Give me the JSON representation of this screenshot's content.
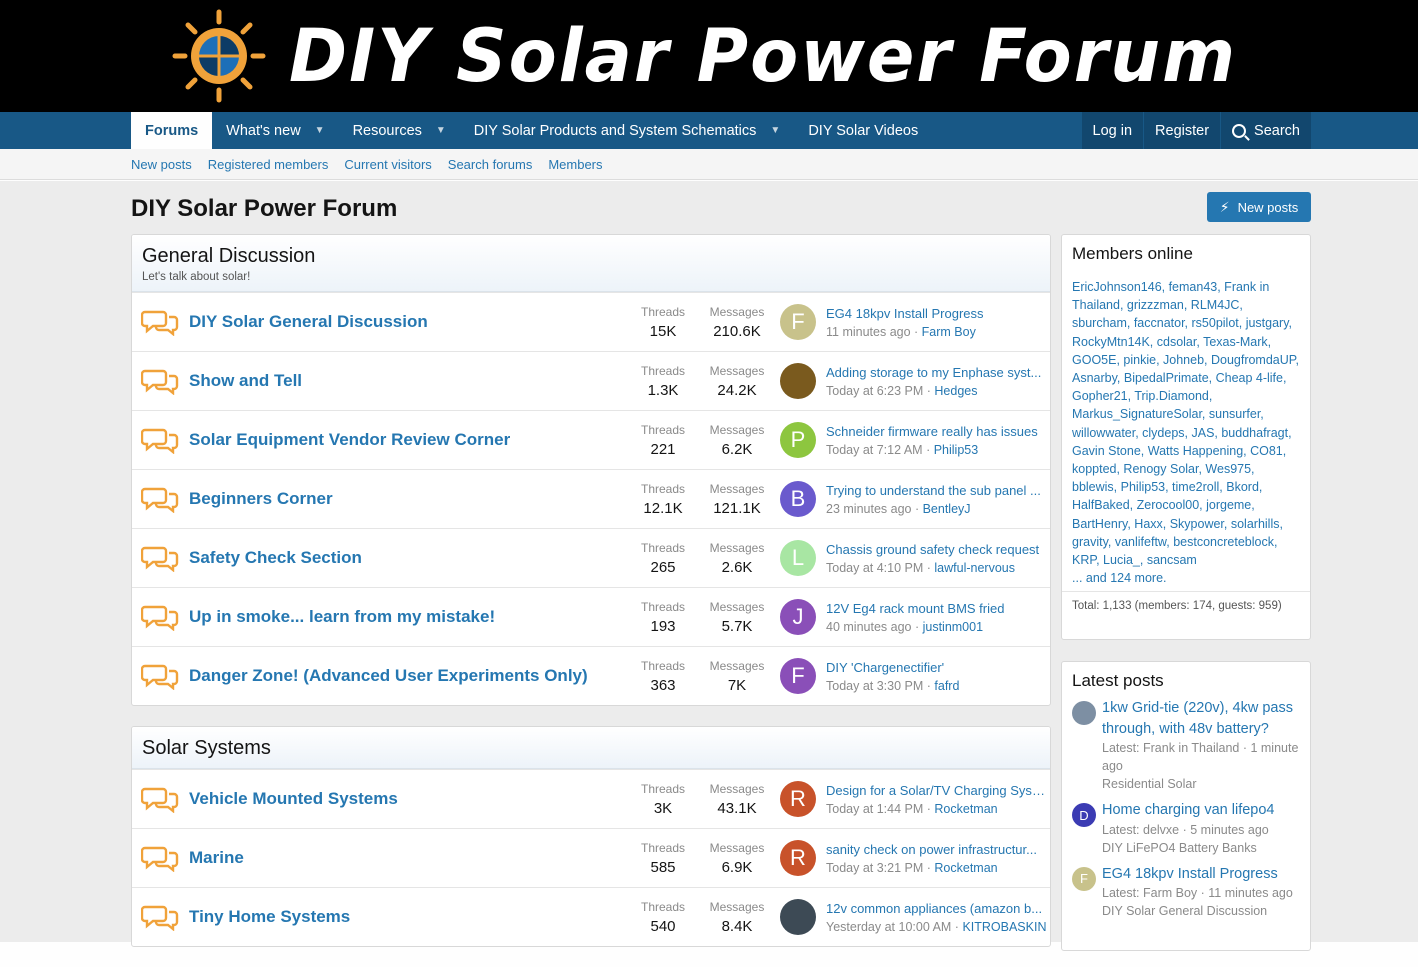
{
  "logo": {
    "text": "DIY Solar Power Forum",
    "sun_icon": "sun-logo-icon"
  },
  "nav": {
    "tabs": [
      {
        "label": "Forums",
        "active": true
      },
      {
        "label": "What's new",
        "caret": true
      },
      {
        "label": "Resources",
        "caret": true
      },
      {
        "label": "DIY Solar Products and System Schematics",
        "caret": true
      },
      {
        "label": "DIY Solar Videos"
      }
    ],
    "login": "Log in",
    "register": "Register",
    "search": "Search"
  },
  "subnav": [
    "New posts",
    "Registered members",
    "Current visitors",
    "Search forums",
    "Members"
  ],
  "page": {
    "title": "DIY Solar Power Forum",
    "new_posts_button": "New posts"
  },
  "categories": [
    {
      "title": "General Discussion",
      "description": "Let's talk about solar!",
      "forums": [
        {
          "title": "DIY Solar General Discussion",
          "threads_label": "Threads",
          "threads": "15K",
          "messages_label": "Messages",
          "messages": "210.6K",
          "avatar_letter": "F",
          "avatar_color": "#c8c28b",
          "last_title": "EG4 18kpv Install Progress",
          "last_time": "11 minutes ago",
          "last_user": "Farm Boy"
        },
        {
          "title": "Show and Tell",
          "threads_label": "Threads",
          "threads": "1.3K",
          "messages_label": "Messages",
          "messages": "24.2K",
          "avatar_letter": "",
          "avatar_color": "#7a5a1e",
          "last_title": "Adding storage to my Enphase syst...",
          "last_time": "Today at 6:23 PM",
          "last_user": "Hedges"
        },
        {
          "title": "Solar Equipment Vendor Review Corner",
          "threads_label": "Threads",
          "threads": "221",
          "messages_label": "Messages",
          "messages": "6.2K",
          "avatar_letter": "P",
          "avatar_color": "#8dc63f",
          "last_title": "Schneider firmware really has issues",
          "last_time": "Today at 7:12 AM",
          "last_user": "Philip53"
        },
        {
          "title": "Beginners Corner",
          "threads_label": "Threads",
          "threads": "12.1K",
          "messages_label": "Messages",
          "messages": "121.1K",
          "avatar_letter": "B",
          "avatar_color": "#6a5acd",
          "last_title": "Trying to understand the sub panel ...",
          "last_time": "23 minutes ago",
          "last_user": "BentleyJ"
        },
        {
          "title": "Safety Check Section",
          "threads_label": "Threads",
          "threads": "265",
          "messages_label": "Messages",
          "messages": "2.6K",
          "avatar_letter": "L",
          "avatar_color": "#a8e6a3",
          "last_title": "Chassis ground safety check request",
          "last_time": "Today at 4:10 PM",
          "last_user": "lawful-nervous"
        },
        {
          "title": "Up in smoke... learn from my mistake!",
          "threads_label": "Threads",
          "threads": "193",
          "messages_label": "Messages",
          "messages": "5.7K",
          "avatar_letter": "J",
          "avatar_color": "#8a4fb8",
          "last_title": "12V Eg4 rack mount BMS fried",
          "last_time": "40 minutes ago",
          "last_user": "justinm001"
        },
        {
          "title": "Danger Zone! (Advanced User Experiments Only)",
          "threads_label": "Threads",
          "threads": "363",
          "messages_label": "Messages",
          "messages": "7K",
          "avatar_letter": "F",
          "avatar_color": "#8a4fb8",
          "last_title": "DIY 'Chargenectifier'",
          "last_time": "Today at 3:30 PM",
          "last_user": "fafrd"
        }
      ]
    },
    {
      "title": "Solar Systems",
      "description": "",
      "forums": [
        {
          "title": "Vehicle Mounted Systems",
          "threads_label": "Threads",
          "threads": "3K",
          "messages_label": "Messages",
          "messages": "43.1K",
          "avatar_letter": "R",
          "avatar_color": "#c8522a",
          "last_title": "Design for a Solar/TV Charging Syst...",
          "last_time": "Today at 1:44 PM",
          "last_user": "Rocketman"
        },
        {
          "title": "Marine",
          "threads_label": "Threads",
          "threads": "585",
          "messages_label": "Messages",
          "messages": "6.9K",
          "avatar_letter": "R",
          "avatar_color": "#c8522a",
          "last_title": "sanity check on power infrastructur...",
          "last_time": "Today at 3:21 PM",
          "last_user": "Rocketman"
        },
        {
          "title": "Tiny Home Systems",
          "threads_label": "Threads",
          "threads": "540",
          "messages_label": "Messages",
          "messages": "8.4K",
          "avatar_letter": "",
          "avatar_color": "#3d4a55",
          "last_title": "12v common appliances (amazon b...",
          "last_time": "Yesterday at 10:00 AM",
          "last_user": "KITROBASKIN"
        }
      ]
    }
  ],
  "members_online": {
    "title": "Members online",
    "names": "EricJohnson146, feman43, Frank in Thailand, grizzzman, RLM4JC, sburcham, faccnator, rs50pilot, justgary, RockyMtn14K, cdsolar, Texas-Mark, GOO5E, pinkie, Johneb, DougfromdaUP, Asnarby, BipedalPrimate, Cheap 4-life, Gopher21, Trip.Diamond, Markus_SignatureSolar, sunsurfer, willowwater, clydeps, JAS, buddhafragt, Gavin Stone, Watts Happening, CO81, koppted, Renogy Solar, Wes975, bblewis, Philip53, time2roll, Bkord, HalfBaked, Zerocool00, jorgeme, BartHenry, Haxx, Skypower, solarhills, gravity, vanlifeftw, bestconcreteblock, KRP, Lucia_, sancsam",
    "more": "... and 124 more.",
    "total": "Total: 1,133 (members: 174, guests: 959)"
  },
  "latest_posts": {
    "title": "Latest posts",
    "items": [
      {
        "avatar_letter": "",
        "avatar_color": "#7d8fa3",
        "title": "1kw Grid-tie (220v), 4kw pass through, with 48v battery?",
        "meta": "Latest: Frank in Thailand · 1 minute ago",
        "forum": "Residential Solar"
      },
      {
        "avatar_letter": "D",
        "avatar_color": "#3b3bb3",
        "title": "Home charging van lifepo4",
        "meta": "Latest: delvxe · 5 minutes ago",
        "forum": "DIY LiFePO4 Battery Banks"
      },
      {
        "avatar_letter": "F",
        "avatar_color": "#c8c28b",
        "title": "EG4 18kpv Install Progress",
        "meta": "Latest: Farm Boy · 11 minutes ago",
        "forum": "DIY Solar General Discussion"
      }
    ]
  },
  "colors": {
    "nav_bg": "#185886",
    "link": "#2577b1",
    "accent_orange": "#f0a23a"
  }
}
